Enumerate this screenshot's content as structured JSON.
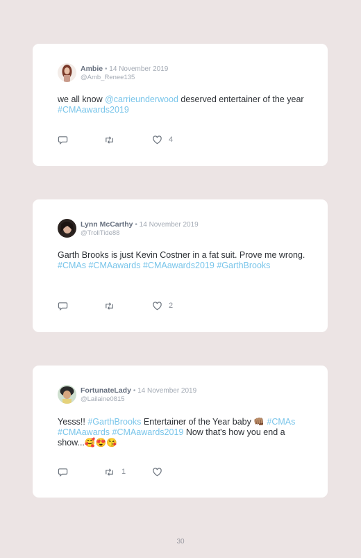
{
  "tweets": [
    {
      "name": "Ambie",
      "date": "• 14 November 2019",
      "handle": "@Amb_Renee135",
      "text": [
        {
          "t": "we all know ",
          "c": "plain"
        },
        {
          "t": "@carrieunderwood",
          "c": "tag"
        },
        {
          "t": " deserved entertainer of the year ",
          "c": "plain"
        },
        {
          "t": "#CMAawards2019",
          "c": "tag"
        }
      ],
      "likes": "4",
      "retweets": ""
    },
    {
      "name": "Lynn McCarthy",
      "date": "• 14 November 2019",
      "handle": "@TrollTide88",
      "text": [
        {
          "t": "Garth Brooks is just Kevin Costner in a fat suit. Prove me wrong. ",
          "c": "plain"
        },
        {
          "t": "#CMAs",
          "c": "tag"
        },
        {
          "t": " ",
          "c": "plain"
        },
        {
          "t": "#CMAawards",
          "c": "tag"
        },
        {
          "t": " ",
          "c": "plain"
        },
        {
          "t": "#CMAawards2019",
          "c": "tag"
        },
        {
          "t": " ",
          "c": "plain"
        },
        {
          "t": "#GarthBrooks",
          "c": "tag"
        }
      ],
      "likes": "2",
      "retweets": ""
    },
    {
      "name": "FortunateLady",
      "date": "• 14 November 2019",
      "handle": "@Lailaine0815",
      "text": [
        {
          "t": "Yesss!! ",
          "c": "plain"
        },
        {
          "t": "#GarthBrooks",
          "c": "tag"
        },
        {
          "t": " Entertainer of the Year baby 👊🏽 ",
          "c": "plain"
        },
        {
          "t": "#CMAs",
          "c": "tag"
        },
        {
          "t": " ",
          "c": "plain"
        },
        {
          "t": "#CMAawards",
          "c": "tag"
        },
        {
          "t": " ",
          "c": "plain"
        },
        {
          "t": "#CMAawards2019",
          "c": "tag"
        },
        {
          "t": " Now that's how you end a show...🥰😍😘",
          "c": "plain"
        }
      ],
      "likes": "",
      "retweets": "1"
    }
  ],
  "page_number": "30",
  "colors": {
    "background": "#ece4e4",
    "card": "#ffffff",
    "hashtag": "#79c5ea",
    "name": "#67707f",
    "meta": "#a3aab4"
  },
  "icons": [
    "reply-icon",
    "retweet-icon",
    "like-icon"
  ]
}
